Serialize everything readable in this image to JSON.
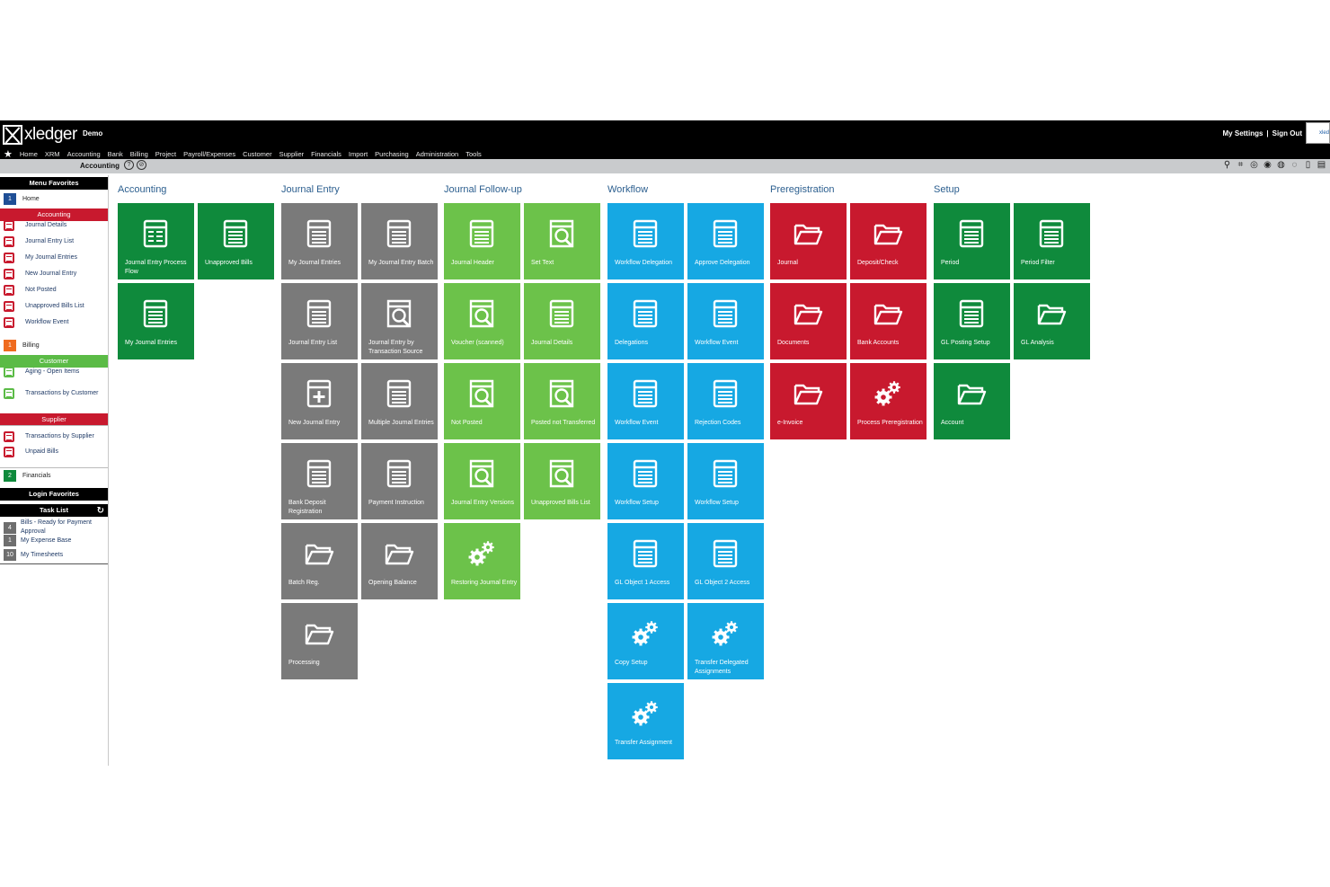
{
  "header": {
    "brand": "xledger",
    "company": "Demo",
    "menu": [
      "Home",
      "XRM",
      "Accounting",
      "Bank",
      "Billing",
      "Project",
      "Payroll/Expenses",
      "Customer",
      "Supplier",
      "Financials",
      "Import",
      "Purchasing",
      "Administration",
      "Tools"
    ],
    "my_settings": "My Settings",
    "separator": "|",
    "sign_out": "Sign Out",
    "corner_logo": "xled"
  },
  "context": {
    "title": "Accounting"
  },
  "sidebar": {
    "menu_favorites": "Menu Favorites",
    "home_num": "1",
    "home": "Home",
    "accounting_header": "Accounting",
    "accounting_items": [
      "Journal Details",
      "Journal Entry List",
      "My Journal Entries",
      "New Journal Entry",
      "Not Posted",
      "Unapproved Bills List",
      "Workflow Event"
    ],
    "billing_num": "1",
    "billing": "Billing",
    "customer_header": "Customer",
    "customer_items": [
      "Aging - Open Items",
      "Transactions by Customer"
    ],
    "supplier_header": "Supplier",
    "supplier_items": [
      "Transactions by Supplier",
      "Unpaid Bills"
    ],
    "financials_num": "2",
    "financials": "Financials",
    "login_favorites": "Login Favorites",
    "task_list": "Task List",
    "tasks": [
      {
        "num": "4",
        "label": "Bills - Ready for Payment Approval"
      },
      {
        "num": "1",
        "label": "My Expense Base"
      },
      {
        "num": "10",
        "label": "My Timesheets"
      }
    ]
  },
  "columns": [
    {
      "title": "Accounting",
      "color": "#0f8a3c",
      "tiles": [
        {
          "label": "Journal Entry Process Flow",
          "icon": "grid-doc-icon"
        },
        {
          "label": "Unapproved Bills",
          "icon": "doc-icon"
        },
        {
          "label": "My Journal Entries",
          "icon": "doc-icon"
        }
      ]
    },
    {
      "title": "Journal Entry",
      "color": "#7a7a7a",
      "tiles": [
        {
          "label": "My Journal Entries",
          "icon": "doc-icon"
        },
        {
          "label": "My Journal Entry Batch",
          "icon": "doc-icon"
        },
        {
          "label": "Journal Entry List",
          "icon": "doc-icon"
        },
        {
          "label": "Journal Entry by Transaction Source",
          "icon": "search-doc-icon"
        },
        {
          "label": "New Journal Entry",
          "icon": "plus-doc-icon"
        },
        {
          "label": "Multiple Journal Entries",
          "icon": "doc-icon"
        },
        {
          "label": "Bank Deposit Registration",
          "icon": "doc-icon"
        },
        {
          "label": "Payment Instruction",
          "icon": "doc-icon"
        },
        {
          "label": "Batch Reg.",
          "icon": "folder-icon"
        },
        {
          "label": "Opening Balance",
          "icon": "folder-icon"
        },
        {
          "label": "Processing",
          "icon": "folder-icon"
        }
      ]
    },
    {
      "title": "Journal Follow-up",
      "color": "#6cc24a",
      "tiles": [
        {
          "label": "Journal Header",
          "icon": "doc-icon"
        },
        {
          "label": "Set Text",
          "icon": "search-doc-icon"
        },
        {
          "label": "Voucher (scanned)",
          "icon": "search-doc-icon"
        },
        {
          "label": "Journal Details",
          "icon": "doc-icon"
        },
        {
          "label": "Not Posted",
          "icon": "search-doc-icon"
        },
        {
          "label": "Posted not Transferred",
          "icon": "search-doc-icon"
        },
        {
          "label": "Journal Entry Versions",
          "icon": "search-doc-icon"
        },
        {
          "label": "Unapproved Bills List",
          "icon": "search-doc-icon"
        },
        {
          "label": "Restoring Journal Entry",
          "icon": "gears-icon"
        }
      ]
    },
    {
      "title": "Workflow",
      "color": "#16a8e3",
      "tiles": [
        {
          "label": "Workflow Delegation",
          "icon": "doc-icon"
        },
        {
          "label": "Approve Delegation",
          "icon": "doc-icon"
        },
        {
          "label": "Delegations",
          "icon": "doc-icon"
        },
        {
          "label": "Workflow Event",
          "icon": "doc-icon"
        },
        {
          "label": "Workflow Event",
          "icon": "doc-icon"
        },
        {
          "label": "Rejection Codes",
          "icon": "doc-icon"
        },
        {
          "label": "Workflow Setup",
          "icon": "doc-icon"
        },
        {
          "label": "Workflow Setup",
          "icon": "doc-icon"
        },
        {
          "label": "GL Object 1 Access",
          "icon": "doc-icon"
        },
        {
          "label": "GL Object 2 Access",
          "icon": "doc-icon"
        },
        {
          "label": "Copy Setup",
          "icon": "gears-icon"
        },
        {
          "label": "Transfer Delegated Assignments",
          "icon": "gears-icon"
        },
        {
          "label": "Transfer Assignment",
          "icon": "gears-icon"
        }
      ]
    },
    {
      "title": "Preregistration",
      "color": "#c8192e",
      "tiles": [
        {
          "label": "Journal",
          "icon": "folder-icon"
        },
        {
          "label": "Deposit/Check",
          "icon": "folder-icon"
        },
        {
          "label": "Documents",
          "icon": "folder-icon"
        },
        {
          "label": "Bank Accounts",
          "icon": "folder-icon"
        },
        {
          "label": "e-Invoice",
          "icon": "folder-icon"
        },
        {
          "label": "Process Preregistration",
          "icon": "gears-icon"
        }
      ]
    },
    {
      "title": "Setup",
      "color": "#0f8a3c",
      "tiles": [
        {
          "label": "Period",
          "icon": "doc-icon"
        },
        {
          "label": "Period Filter",
          "icon": "doc-icon"
        },
        {
          "label": "GL Posting Setup",
          "icon": "doc-icon"
        },
        {
          "label": "GL Analysis",
          "icon": "folder-icon"
        },
        {
          "label": "Account",
          "icon": "folder-icon"
        }
      ]
    }
  ]
}
